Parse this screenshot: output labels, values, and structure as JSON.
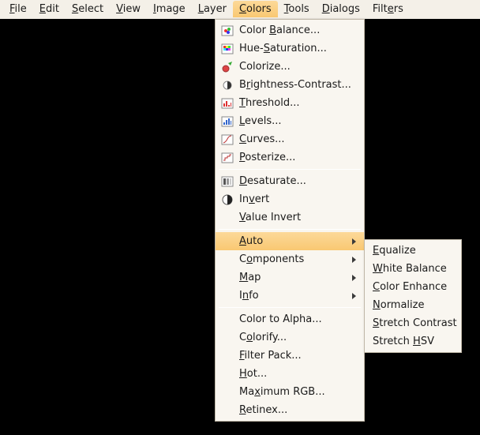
{
  "menubar": {
    "items": [
      {
        "label": "File",
        "mn": 0
      },
      {
        "label": "Edit",
        "mn": 0
      },
      {
        "label": "Select",
        "mn": 0
      },
      {
        "label": "View",
        "mn": 0
      },
      {
        "label": "Image",
        "mn": 0
      },
      {
        "label": "Layer",
        "mn": 0
      },
      {
        "label": "Colors",
        "mn": 0,
        "open": true
      },
      {
        "label": "Tools",
        "mn": 0
      },
      {
        "label": "Dialogs",
        "mn": 0
      },
      {
        "label": "Filters",
        "mn": 4
      }
    ]
  },
  "colors_menu": {
    "groups": [
      [
        {
          "label": "Color Balance...",
          "mn": 6,
          "icon": "color-balance"
        },
        {
          "label": "Hue-Saturation...",
          "mn": 4,
          "icon": "hue-sat"
        },
        {
          "label": "Colorize...",
          "mn": -1,
          "icon": "colorize"
        },
        {
          "label": "Brightness-Contrast...",
          "mn": 1,
          "icon": "bright-contrast"
        },
        {
          "label": "Threshold...",
          "mn": 0,
          "icon": "threshold"
        },
        {
          "label": "Levels...",
          "mn": 0,
          "icon": "levels"
        },
        {
          "label": "Curves...",
          "mn": 0,
          "icon": "curves"
        },
        {
          "label": "Posterize...",
          "mn": 0,
          "icon": "posterize"
        }
      ],
      [
        {
          "label": "Desaturate...",
          "mn": 0,
          "icon": "desaturate"
        },
        {
          "label": "Invert",
          "mn": 2,
          "icon": "invert"
        },
        {
          "label": "Value Invert",
          "mn": 0,
          "no_icon": true
        }
      ],
      [
        {
          "label": "Auto",
          "mn": 0,
          "no_icon": true,
          "submenu": true,
          "highlight": true
        },
        {
          "label": "Components",
          "mn": 1,
          "no_icon": true,
          "submenu": true
        },
        {
          "label": "Map",
          "mn": 0,
          "no_icon": true,
          "submenu": true
        },
        {
          "label": "Info",
          "mn": 1,
          "no_icon": true,
          "submenu": true
        }
      ],
      [
        {
          "label": "Color to Alpha...",
          "mn": -1,
          "no_icon": true
        },
        {
          "label": "Colorify...",
          "mn": 1,
          "no_icon": true
        },
        {
          "label": "Filter Pack...",
          "mn": 0,
          "no_icon": true
        },
        {
          "label": "Hot...",
          "mn": 0,
          "no_icon": true
        },
        {
          "label": "Maximum RGB...",
          "mn": 2,
          "no_icon": true
        },
        {
          "label": "Retinex...",
          "mn": 0,
          "no_icon": true
        }
      ]
    ]
  },
  "auto_menu": {
    "items": [
      {
        "label": "Equalize",
        "mn": 0
      },
      {
        "label": "White Balance",
        "mn": 0
      },
      {
        "label": "Color Enhance",
        "mn": 0
      },
      {
        "label": "Normalize",
        "mn": 0
      },
      {
        "label": "Stretch Contrast",
        "mn": 0
      },
      {
        "label": "Stretch HSV",
        "mn": 8
      }
    ]
  }
}
